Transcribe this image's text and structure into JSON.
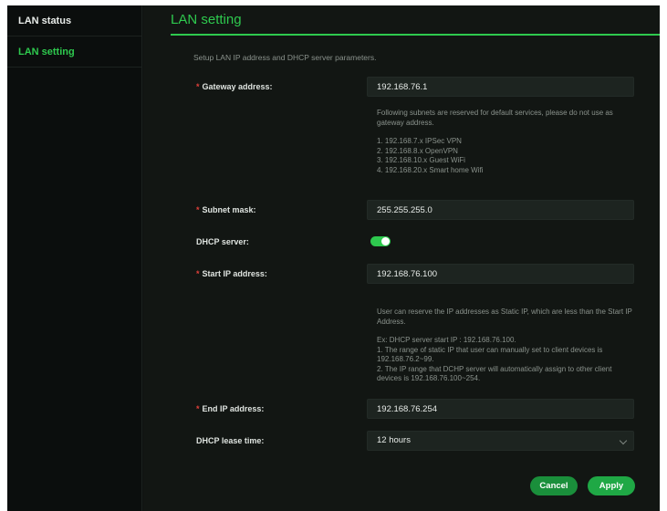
{
  "sidebar": {
    "items": [
      {
        "label": "LAN status"
      },
      {
        "label": "LAN setting"
      }
    ]
  },
  "page": {
    "title": "LAN setting",
    "intro": "Setup LAN IP address and DHCP server parameters."
  },
  "gateway": {
    "label": "Gateway address:",
    "value": "192.168.76.1",
    "note": [
      "Following subnets are reserved for default services, please do not use as gateway address.",
      "1. 192.168.7.x IPSec VPN",
      "2. 192.168.8.x OpenVPN",
      "3. 192.168.10.x Guest WiFi",
      "4. 192.168.20.x Smart home Wifi"
    ]
  },
  "subnet": {
    "label": "Subnet mask:",
    "value": "255.255.255.0"
  },
  "dhcp": {
    "label": "DHCP server:",
    "enabled": true
  },
  "start_ip": {
    "label": "Start IP address:",
    "value": "192.168.76.100",
    "note": [
      "User can reserve the IP addresses as Static IP, which are less than the Start IP Address.",
      "Ex: DHCP server start IP : 192.168.76.100.",
      "1. The range of static IP that user can manually set to client devices is 192.168.76.2~99.",
      "2. The IP range that DCHP server will automatically assign to other client devices is 192.168.76.100~254."
    ]
  },
  "end_ip": {
    "label": "End IP address:",
    "value": "192.168.76.254"
  },
  "lease": {
    "label": "DHCP lease time:",
    "value": "12 hours"
  },
  "buttons": {
    "cancel": "Cancel",
    "apply": "Apply"
  },
  "colors": {
    "accent": "#2ec94e",
    "required": "#e0403a",
    "background": "#121613"
  }
}
